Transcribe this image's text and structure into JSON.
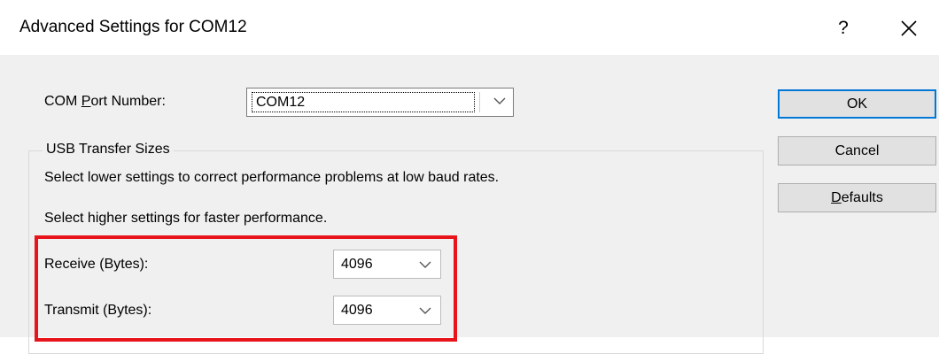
{
  "window": {
    "title": "Advanced Settings for COM12",
    "help_label": "?"
  },
  "com_port": {
    "label_pre": "COM ",
    "label_access": "P",
    "label_post": "ort Number:",
    "value": "COM12"
  },
  "usb_transfer": {
    "group_title": "USB Transfer Sizes",
    "hint_lower": "Select lower settings to correct performance problems at low baud rates.",
    "hint_higher": "Select higher settings for faster performance.",
    "receive_label": "Receive (Bytes):",
    "receive_value": "4096",
    "transmit_label": "Transmit (Bytes):",
    "transmit_value": "4096"
  },
  "buttons": {
    "ok": "OK",
    "cancel": "Cancel",
    "defaults_access": "D",
    "defaults_rest": "efaults"
  },
  "icons": {
    "close": "close-icon",
    "help": "help-icon",
    "dropdown": "chevron-down-icon"
  },
  "colors": {
    "highlight": "#e8141b",
    "default_button_border": "#0078d7",
    "dialog_background": "#f0f0f0"
  }
}
